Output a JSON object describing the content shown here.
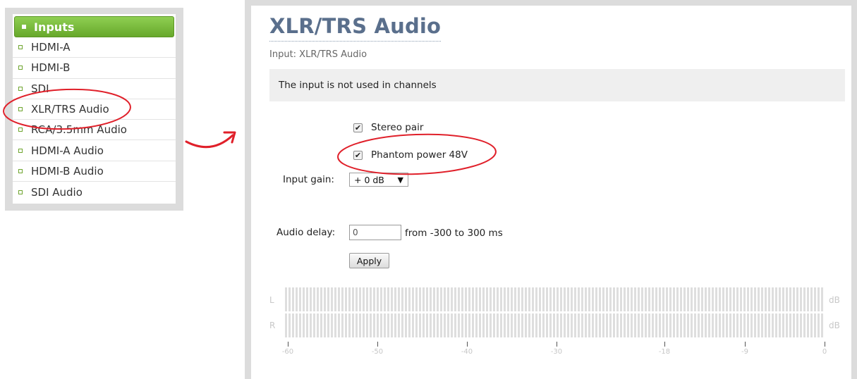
{
  "sidebar": {
    "header": "Inputs",
    "items": [
      {
        "label": "HDMI-A"
      },
      {
        "label": "HDMI-B"
      },
      {
        "label": "SDI"
      },
      {
        "label": "XLR/TRS Audio"
      },
      {
        "label": "RCA/3.5mm Audio"
      },
      {
        "label": "HDMI-A Audio"
      },
      {
        "label": "HDMI-B Audio"
      },
      {
        "label": "SDI Audio"
      }
    ]
  },
  "main": {
    "title": "XLR/TRS Audio",
    "input_label": "Input: XLR/TRS Audio",
    "notice": "The input is not used in channels",
    "stereo_pair": {
      "label": "Stereo pair",
      "checked": true
    },
    "phantom_power": {
      "label": "Phantom power 48V",
      "checked": true
    },
    "input_gain": {
      "label": "Input gain:",
      "value": "+ 0 dB"
    },
    "audio_delay": {
      "label": "Audio delay:",
      "value": "0",
      "range_text": "from -300 to 300 ms"
    },
    "apply_label": "Apply",
    "meters": {
      "left_label": "L",
      "right_label": "R",
      "unit": "dB",
      "scale": [
        "-60",
        "-50",
        "-40",
        "-30",
        "-18",
        "-9",
        "0"
      ]
    }
  },
  "colors": {
    "header_green": "#6aa82c",
    "title_blue": "#5a6f8c",
    "annotation_red": "#e0202a"
  }
}
